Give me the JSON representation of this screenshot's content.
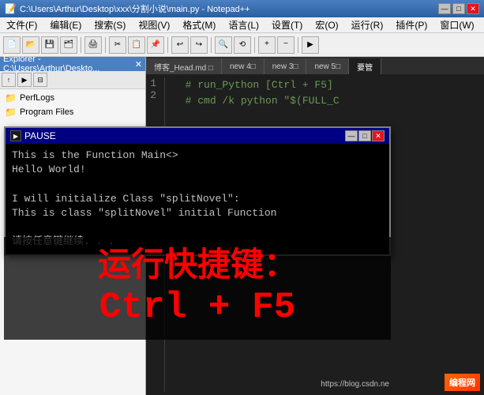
{
  "titlebar": {
    "title": "C:\\Users\\Arthur\\Desktop\\xxx\\分割小说\\main.py - Notepad++",
    "minimize": "—",
    "maximize": "□",
    "close": "✕"
  },
  "menubar": {
    "items": [
      "文件(F)",
      "编辑(E)",
      "搜索(S)",
      "视图(V)",
      "格式(M)",
      "语言(L)",
      "设置(T)",
      "宏(O)",
      "运行(R)",
      "插件(P)",
      "窗口(W)",
      "?"
    ]
  },
  "explorer": {
    "header": "Explorer - C:\\Users\\Arthur\\Deskto...",
    "close": "✕",
    "items": [
      "PerfLogs",
      "Program Files"
    ]
  },
  "tabs": {
    "items": [
      "博客_Head.md□",
      "new 4□",
      "new 3□",
      "new 5□",
      "要管"
    ]
  },
  "code": {
    "lines": [
      {
        "num": "1",
        "text": "  # run_Python [Ctrl + F5]"
      },
      {
        "num": "2",
        "text": "  # cmd /k python \"$(FULL_C"
      }
    ]
  },
  "cmd": {
    "title": "PAUSE",
    "icon": "▶",
    "minimize": "—",
    "maximize": "□",
    "close": "✕",
    "content": [
      "This is the Function Main<>",
      "Hello World!",
      "",
      "I will initialize Class \"splitNovel\":",
      "This is class \"splitNovel\" initial Function",
      "",
      "请按任意键继续. . ."
    ]
  },
  "overlay": {
    "line1": "运行快捷键：",
    "line2": "Ctrl + F5"
  },
  "watermark": {
    "url": "https://blog.csdn.ne",
    "badge": "编程网"
  }
}
